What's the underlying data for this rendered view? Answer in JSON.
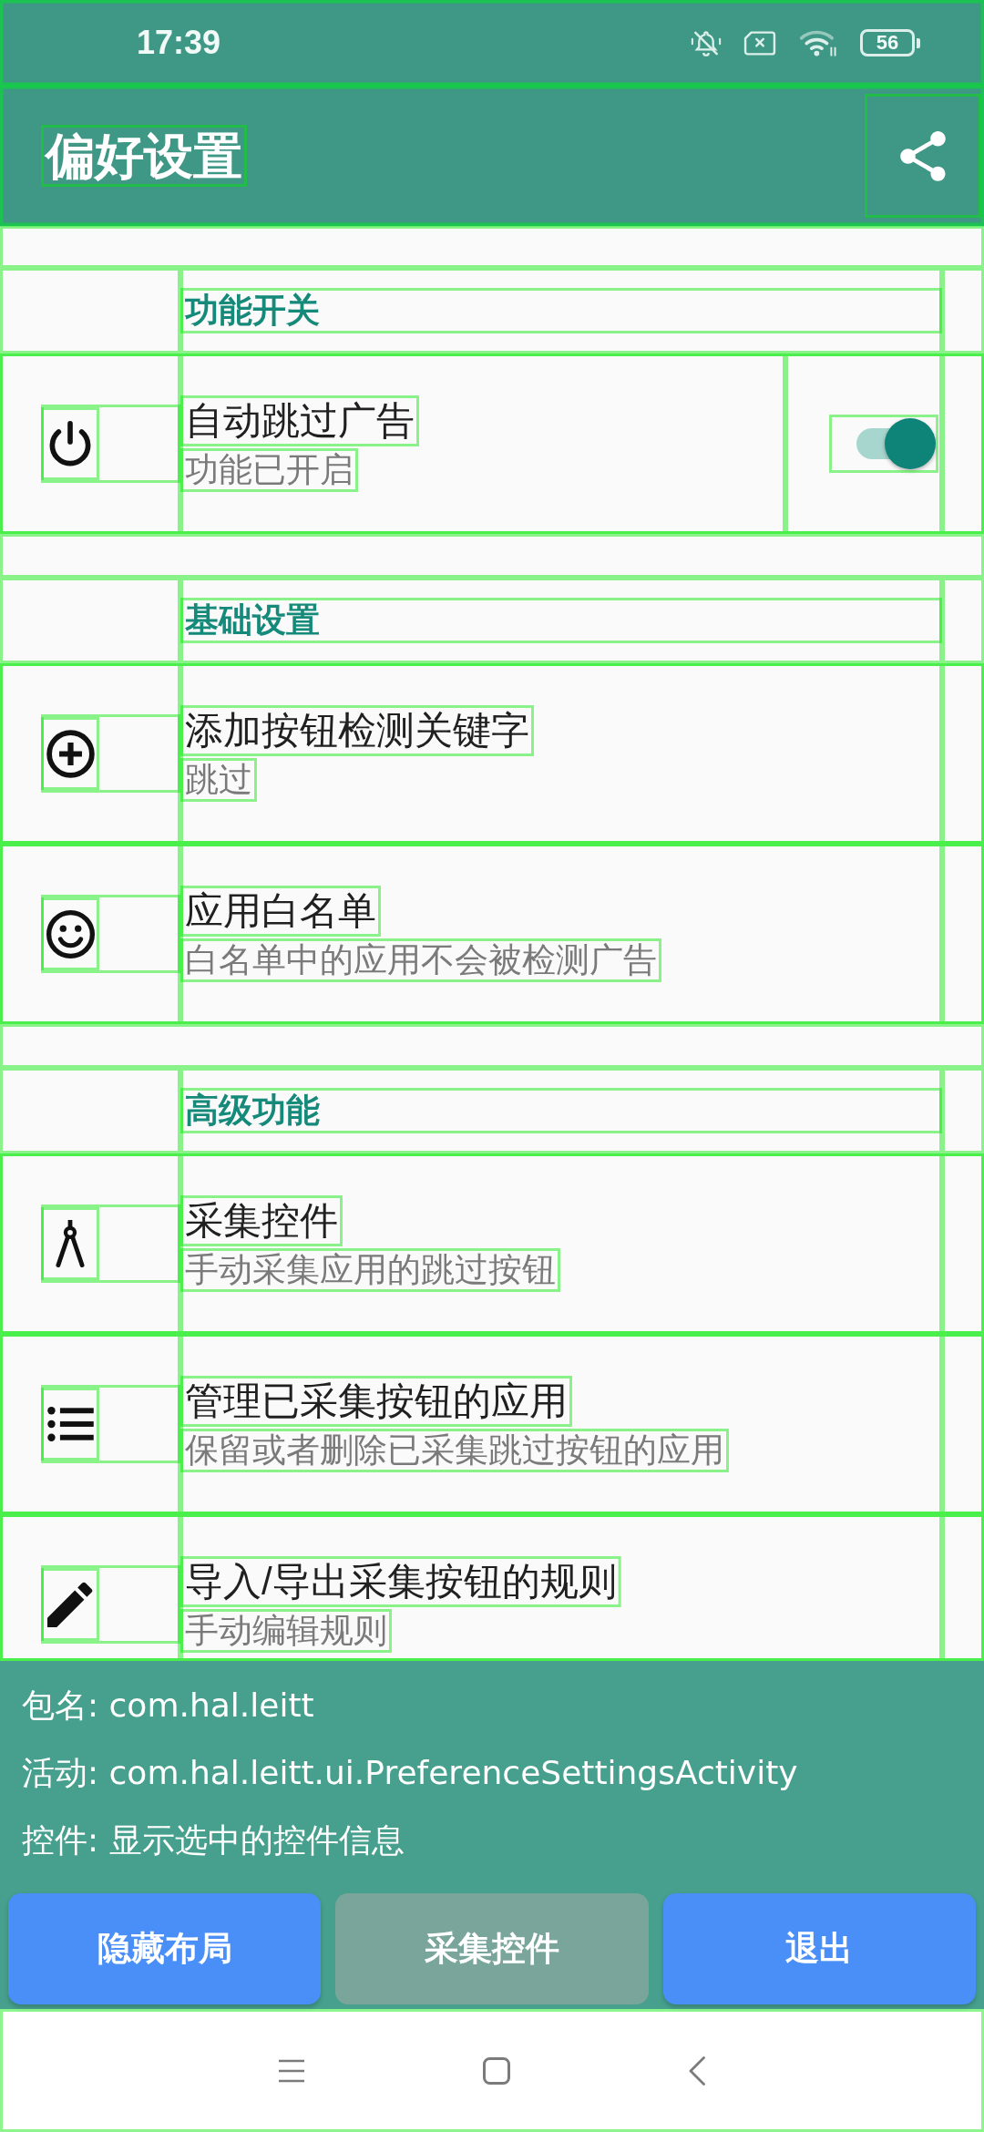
{
  "status_bar": {
    "time": "17:39",
    "battery": "56"
  },
  "app_bar": {
    "title": "偏好设置"
  },
  "layout_bounds_visible": true,
  "sections": [
    {
      "title": "功能开关",
      "items": [
        {
          "kind": "switch",
          "title": "自动跳过广告",
          "summary": "功能已开启",
          "on": true
        }
      ]
    },
    {
      "title": "基础设置",
      "items": [
        {
          "kind": "plain",
          "title": "添加按钮检测关键字",
          "summary": "跳过"
        },
        {
          "kind": "plain",
          "title": "应用白名单",
          "summary": "白名单中的应用不会被检测广告"
        }
      ]
    },
    {
      "title": "高级功能",
      "items": [
        {
          "kind": "plain",
          "title": "采集控件",
          "summary": "手动采集应用的跳过按钮"
        },
        {
          "kind": "plain",
          "title": "管理已采集按钮的应用",
          "summary": "保留或者删除已采集跳过按钮的应用"
        },
        {
          "kind": "plain",
          "title": "导入/导出采集按钮的规则",
          "summary": "手动编辑规则"
        }
      ]
    }
  ],
  "inspector_panel": {
    "lines": [
      "包名: com.hal.leitt",
      "活动: com.hal.leitt.ui.PreferenceSettingsActivity",
      "控件: 显示选中的控件信息"
    ],
    "buttons": [
      {
        "label": "隐藏布局",
        "disabled": false
      },
      {
        "label": "采集控件",
        "disabled": true
      },
      {
        "label": "退出",
        "disabled": false
      }
    ]
  }
}
